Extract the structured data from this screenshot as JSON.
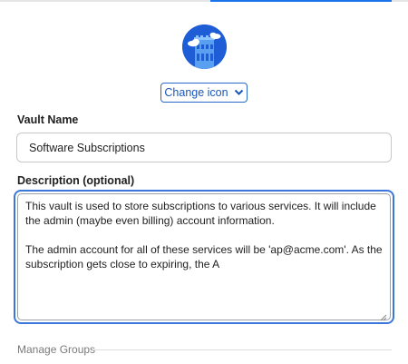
{
  "header": {
    "vault_icon": "cloud-tower-icon",
    "change_icon_label": "Change icon",
    "chevron_icon": "chevron-down-icon"
  },
  "form": {
    "vault_name_label": "Vault Name",
    "vault_name_value": "Software Subscriptions",
    "description_label": "Description (optional)",
    "description_value": "This vault is used to store subscriptions to various services. It will include the admin (maybe even billing) account information.\n\nThe admin account for all of these services will be 'ap@acme.com'. As the subscription gets close to expiring, the A",
    "manage_groups_label": "Manage Groups"
  },
  "colors": {
    "accent": "#1a73e8",
    "icon_bg": "#1e5dd6",
    "button_border": "#2a68c9"
  }
}
